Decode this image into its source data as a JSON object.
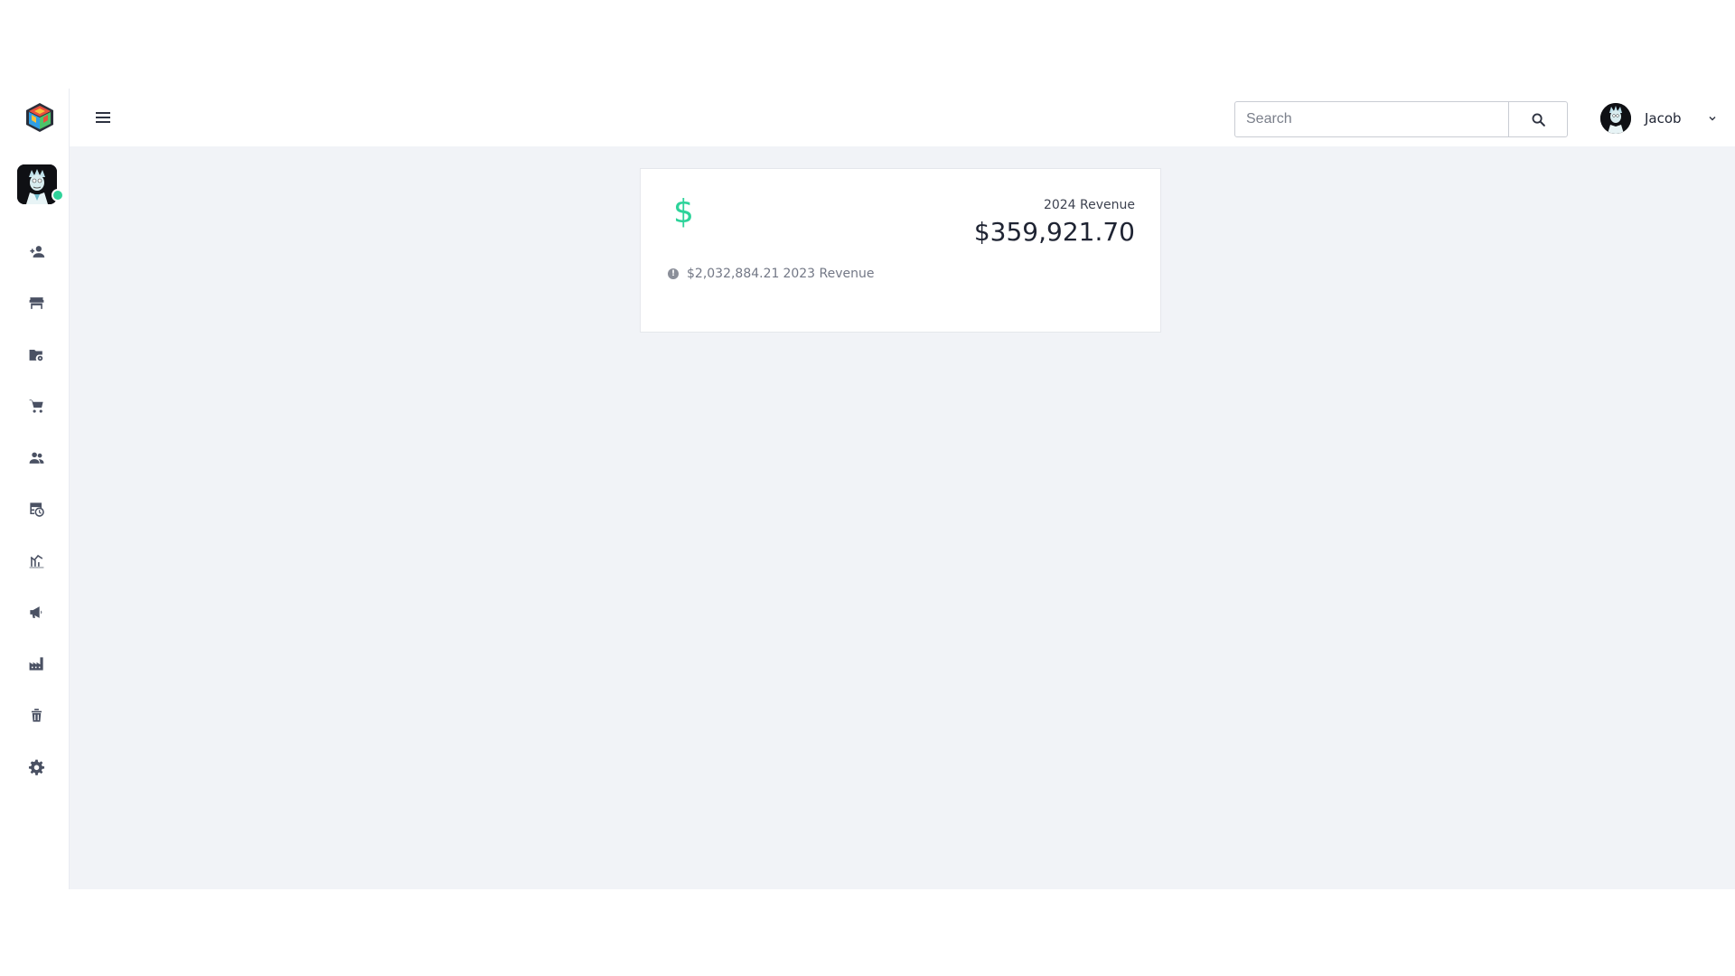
{
  "topbar": {
    "search_placeholder": "Search",
    "search_value": "",
    "user_name": "Jacob"
  },
  "sidebar": {
    "items": [
      {
        "name": "add-user",
        "icon": "person-add-icon"
      },
      {
        "name": "store",
        "icon": "store-icon"
      },
      {
        "name": "folder-settings",
        "icon": "folder-gear-icon"
      },
      {
        "name": "cart",
        "icon": "shopping-cart-icon"
      },
      {
        "name": "customers",
        "icon": "people-icon"
      },
      {
        "name": "schedule",
        "icon": "table-clock-icon"
      },
      {
        "name": "analytics",
        "icon": "chart-icon"
      },
      {
        "name": "campaigns",
        "icon": "megaphone-icon"
      },
      {
        "name": "factory",
        "icon": "factory-icon"
      },
      {
        "name": "trash",
        "icon": "trash-icon"
      },
      {
        "name": "settings",
        "icon": "gear-icon"
      }
    ]
  },
  "card": {
    "current_label": "2024 Revenue",
    "current_value": "$359,921.70",
    "previous_value": "$2,032,884.21",
    "previous_label": "2023 Revenue"
  },
  "colors": {
    "accent": "#2dd39a",
    "content_bg": "#f1f3f7",
    "icon": "#4a5163"
  }
}
